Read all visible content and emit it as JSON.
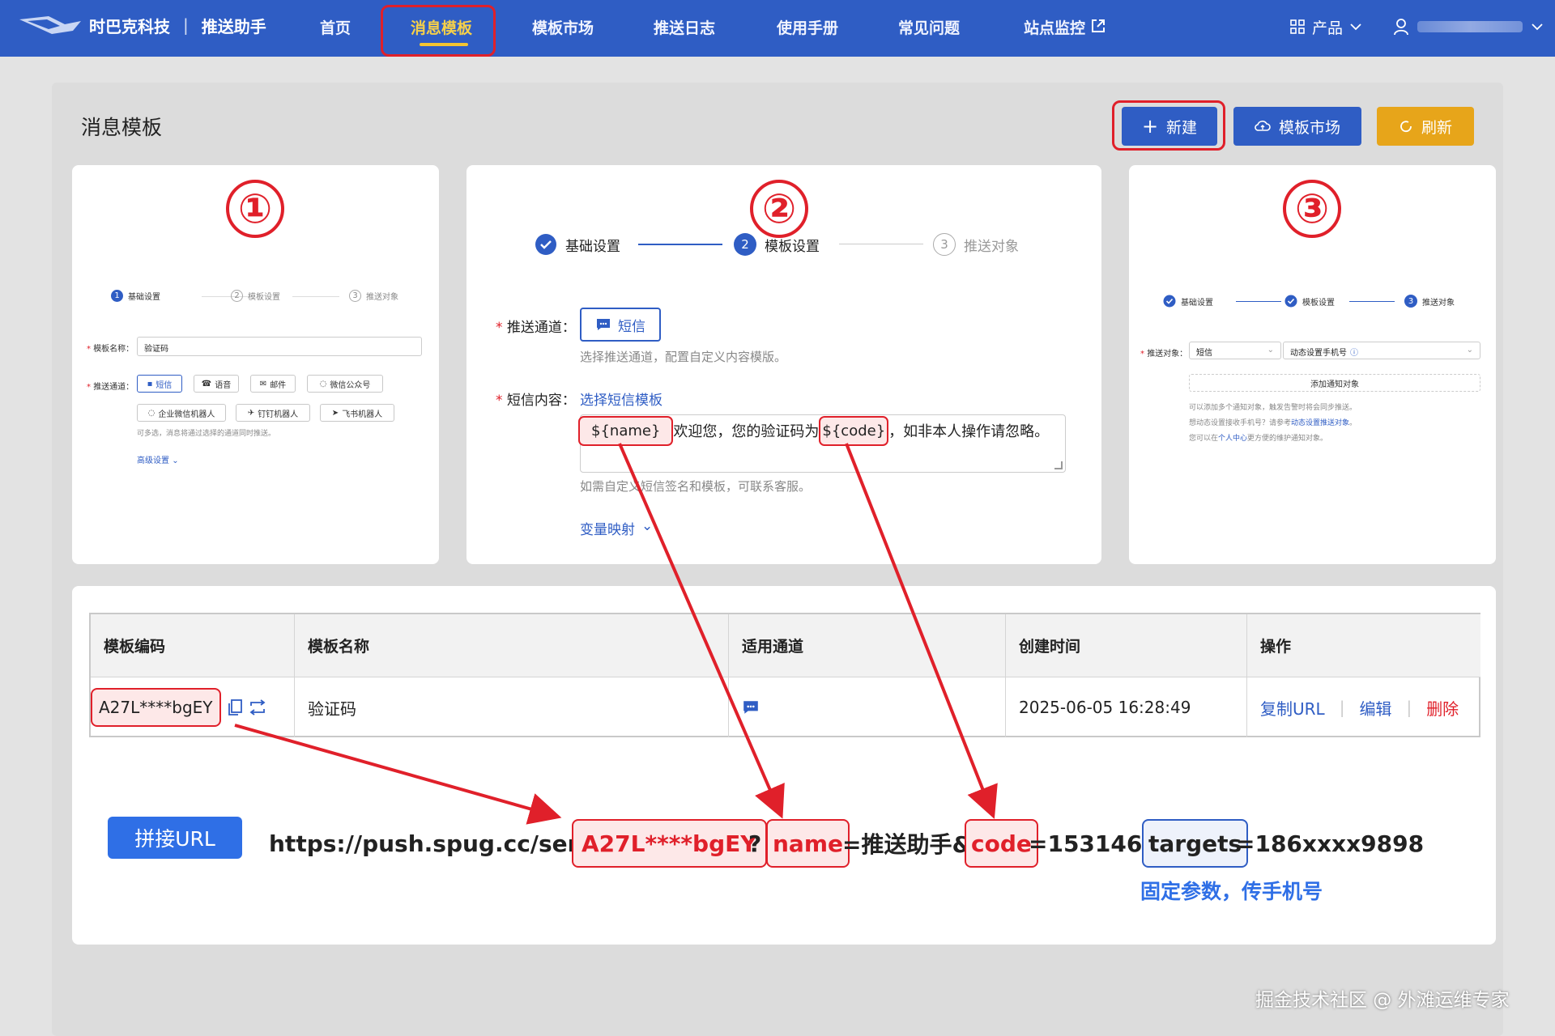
{
  "topbar": {
    "brand": "时巴克科技",
    "separator": "|",
    "app_name": "推送助手",
    "nav": [
      "首页",
      "消息模板",
      "模板市场",
      "推送日志",
      "使用手册",
      "常见问题",
      "站点监控"
    ],
    "products_label": "产品"
  },
  "page": {
    "title": "消息模板",
    "new_button": "新建",
    "market_button": "模板市场",
    "refresh_button": "刷新"
  },
  "panel1": {
    "number": "①",
    "steps": [
      "基础设置",
      "模板设置",
      "推送对象"
    ],
    "step_nums": [
      "1",
      "2",
      "3"
    ],
    "name_label": "模板名称：",
    "name_value": "验证码",
    "channel_label": "推送通道：",
    "channels_row1": [
      "短信",
      "语音",
      "邮件",
      "微信公众号"
    ],
    "channels_row2": [
      "企业微信机器人",
      "钉钉机器人",
      "飞书机器人"
    ],
    "channel_hint": "可多选，消息将通过选择的通道同时推送。",
    "advanced": "高级设置"
  },
  "panel2": {
    "number": "②",
    "steps": [
      "基础设置",
      "模板设置",
      "推送对象"
    ],
    "step_nums": [
      "2",
      "3"
    ],
    "channel_label": "推送通道：",
    "channel_button": "短信",
    "channel_hint": "选择推送通道，配置自定义内容模版。",
    "content_label": "短信内容：",
    "content_link": "选择短信模板",
    "content_var_name": "${name}",
    "content_text_1": "欢迎您，您的验证码为",
    "content_var_code": "${code}",
    "content_text_2": "，如非本人操作请忽略。",
    "content_hint": "如需自定义短信签名和模板，可联系客服。",
    "var_mapping": "变量映射"
  },
  "panel3": {
    "number": "③",
    "steps": [
      "基础设置",
      "模板设置",
      "推送对象"
    ],
    "step_num_3": "3",
    "target_label": "推送对象：",
    "target_select": "短信",
    "target_select2": "动态设置手机号",
    "add_target": "添加通知对象",
    "hint1": "可以添加多个通知对象，触发告警时将会同步推送。",
    "hint2_prefix": "想动态设置接收手机号？请参考",
    "hint2_link": "动态设置推送对象",
    "hint2_suffix": "。",
    "hint3_prefix": "您可以在",
    "hint3_link": "个人中心",
    "hint3_suffix": "更方便的维护通知对象。"
  },
  "table": {
    "headers": [
      "模板编码",
      "模板名称",
      "适用通道",
      "创建时间",
      "操作"
    ],
    "row": {
      "code": "A27L****bgEY",
      "name": "验证码",
      "created": "2025-06-05 16:28:49",
      "actions": [
        "复制URL",
        "编辑",
        "删除"
      ],
      "action_sep": "|"
    }
  },
  "url_builder": {
    "button": "拼接URL",
    "base": "https://push.spug.cc/send/",
    "code": "A27L****bgEY",
    "q": "?",
    "name_key": "name",
    "name_val": "=推送助手&",
    "code_key": "code",
    "code_val": "=153146&",
    "targets_key": "targets",
    "targets_val": "=186xxxx9898",
    "note": "固定参数，传手机号"
  },
  "watermark": "掘金技术社区 @ 外滩运维专家",
  "colors": {
    "primary": "#2f5dc4",
    "red": "#e0202a",
    "gold": "#e7a51a"
  }
}
